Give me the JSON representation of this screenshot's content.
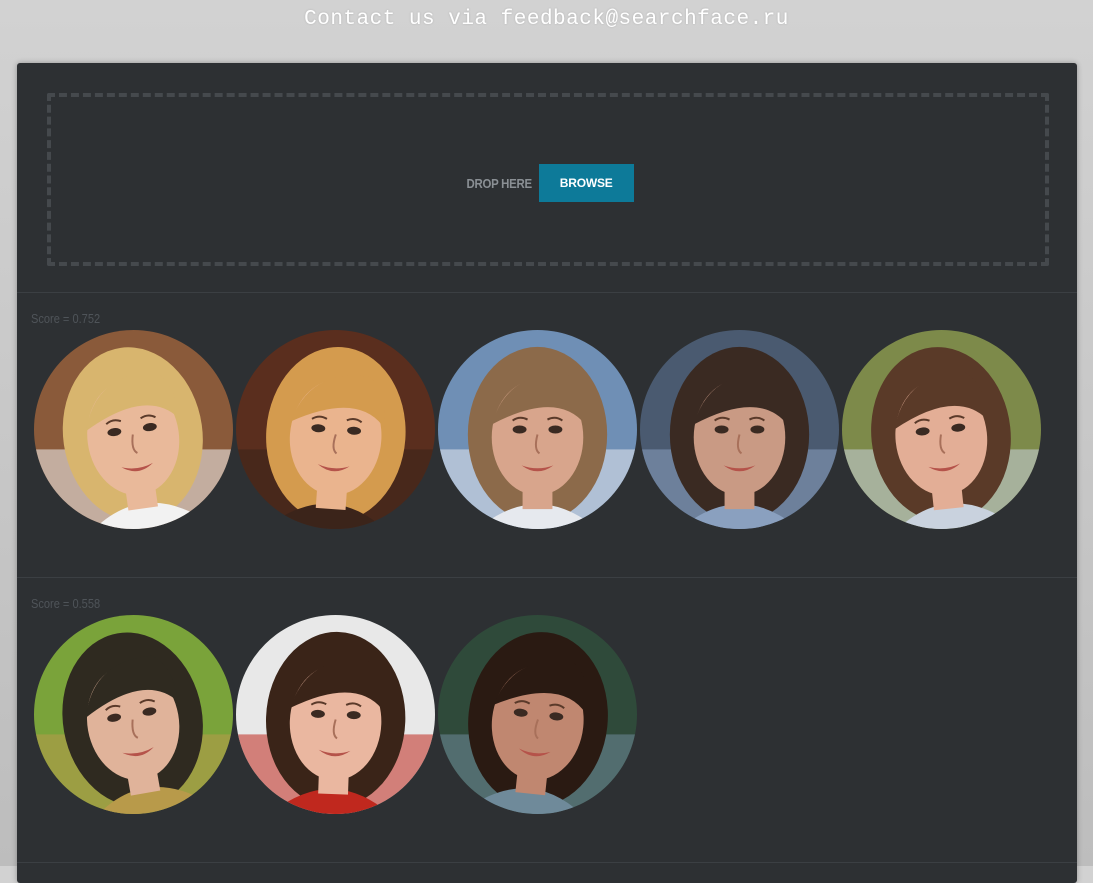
{
  "header": {
    "contact_text": "Contact us via feedback@searchface.ru"
  },
  "dropzone": {
    "drop_label": "DROP HERE",
    "browse_label": "BROWSE"
  },
  "colors": {
    "accent": "#0d7a99",
    "panel": "#2d3033",
    "page_bg": "#c6c6c6"
  },
  "results": [
    {
      "score_label": "Score = 0.752",
      "photos": [
        {
          "hair": "#d8b56e",
          "skin": "#e9b99a",
          "bg": "#8a5a3a",
          "accent": "#f2f2f2"
        },
        {
          "hair": "#d49b4e",
          "skin": "#eab48e",
          "bg": "#5a2e1e",
          "accent": "#3b241a"
        },
        {
          "hair": "#8c6a4a",
          "skin": "#d8a58c",
          "bg": "#6f8fb5",
          "accent": "#e6e9ee"
        },
        {
          "hair": "#3a2a22",
          "skin": "#c99a84",
          "bg": "#4a5a70",
          "accent": "#8aa0bf"
        },
        {
          "hair": "#5a3a28",
          "skin": "#e3ae96",
          "bg": "#7d8a4a",
          "accent": "#c9d2de"
        }
      ]
    },
    {
      "score_label": "Score = 0.558",
      "photos": [
        {
          "hair": "#2f2a20",
          "skin": "#e0b39a",
          "bg": "#7aa33a",
          "accent": "#b89a4a"
        },
        {
          "hair": "#3a2418",
          "skin": "#eab7a0",
          "bg": "#e8e8e8",
          "accent": "#c0281e"
        },
        {
          "hair": "#2a1a12",
          "skin": "#c08770",
          "bg": "#2f4a3a",
          "accent": "#6f8a9a"
        }
      ]
    }
  ]
}
